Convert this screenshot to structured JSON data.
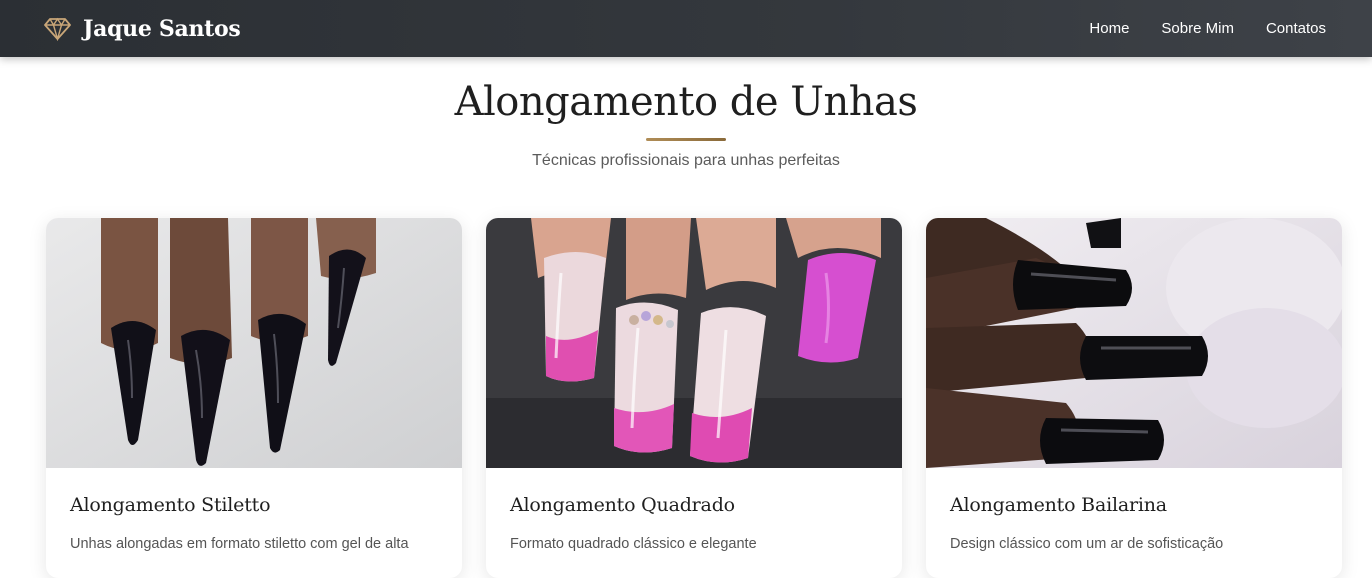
{
  "nav": {
    "brand": "Jaque Santos",
    "brand_icon": "diamond-icon",
    "links": [
      "Home",
      "Sobre Mim",
      "Contatos"
    ]
  },
  "hero": {
    "title": "Alongamento de Unhas",
    "subtitle": "Técnicas profissionais para unhas perfeitas"
  },
  "cards": [
    {
      "title": "Alongamento Stiletto",
      "description": "Unhas alongadas em formato stiletto com gel de alta",
      "nail_color": "#111018"
    },
    {
      "title": "Alongamento Quadrado",
      "description": "Formato quadrado clássico e elegante",
      "nail_color": "#d64fd0"
    },
    {
      "title": "Alongamento Bailarina",
      "description": "Design clássico com um ar de sofisticação",
      "nail_color": "#0c0c0e"
    }
  ],
  "colors": {
    "navbar": "#34383d",
    "accent_gold": "#b08d57"
  }
}
